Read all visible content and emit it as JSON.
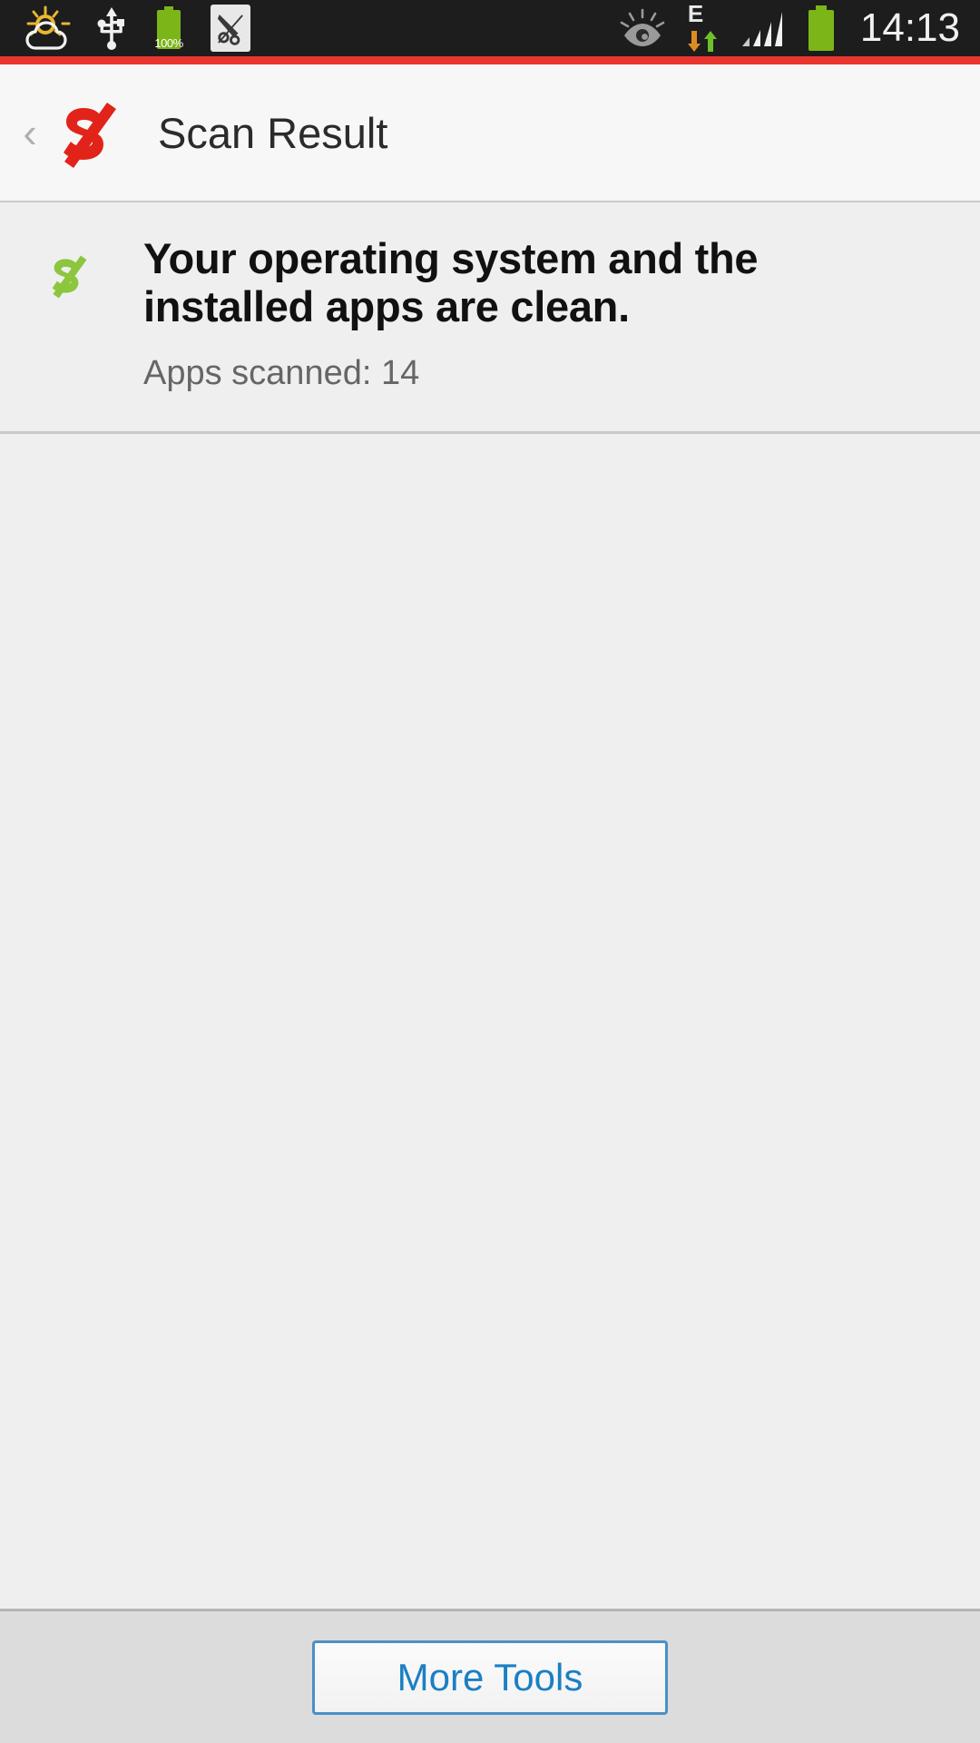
{
  "status_bar": {
    "time": "14:13",
    "battery_percent": "100%",
    "network_type": "E",
    "icons": [
      "weather-cloud-sun-icon",
      "usb-icon",
      "battery-charge-icon",
      "screenshot-capture-icon",
      "smart-stay-eye-icon",
      "edge-data-icon",
      "signal-bars-icon",
      "battery-icon"
    ],
    "colors": {
      "background": "#1d1d1d",
      "battery_green": "#7cb518",
      "accent_red": "#e8352e",
      "arrow_down": "#e08b20",
      "arrow_up": "#6fbf2a"
    }
  },
  "header": {
    "back_label": "‹",
    "title": "Scan Result",
    "logo_name": "app-logo-red",
    "logo_color": "#e2231a"
  },
  "result": {
    "logo_name": "scan-clean-logo-green",
    "logo_color": "#8cc63e",
    "headline": "Your operating system and the installed apps are clean.",
    "apps_scanned_label": "Apps scanned: 14"
  },
  "bottom": {
    "more_tools_label": "More Tools",
    "button_border_color": "#4a90c4",
    "button_text_color": "#1b7fc4"
  }
}
